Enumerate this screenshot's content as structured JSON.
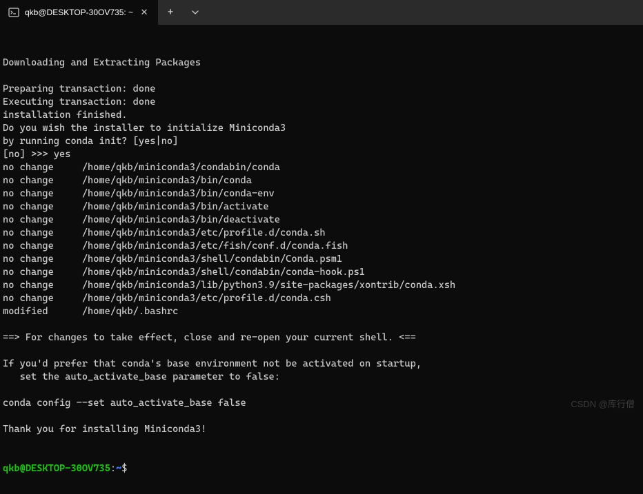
{
  "tab": {
    "title": "qkb@DESKTOP-30OV735: ~"
  },
  "terminal": {
    "lines": [
      "Downloading and Extracting Packages",
      "",
      "Preparing transaction: done",
      "Executing transaction: done",
      "installation finished.",
      "Do you wish the installer to initialize Miniconda3",
      "by running conda init? [yes|no]",
      "[no] >>> yes",
      "no change     /home/qkb/miniconda3/condabin/conda",
      "no change     /home/qkb/miniconda3/bin/conda",
      "no change     /home/qkb/miniconda3/bin/conda-env",
      "no change     /home/qkb/miniconda3/bin/activate",
      "no change     /home/qkb/miniconda3/bin/deactivate",
      "no change     /home/qkb/miniconda3/etc/profile.d/conda.sh",
      "no change     /home/qkb/miniconda3/etc/fish/conf.d/conda.fish",
      "no change     /home/qkb/miniconda3/shell/condabin/Conda.psm1",
      "no change     /home/qkb/miniconda3/shell/condabin/conda-hook.ps1",
      "no change     /home/qkb/miniconda3/lib/python3.9/site-packages/xontrib/conda.xsh",
      "no change     /home/qkb/miniconda3/etc/profile.d/conda.csh",
      "modified      /home/qkb/.bashrc",
      "",
      "==> For changes to take effect, close and re-open your current shell. <==",
      "",
      "If you'd prefer that conda's base environment not be activated on startup,",
      "   set the auto_activate_base parameter to false:",
      "",
      "conda config --set auto_activate_base false",
      "",
      "Thank you for installing Miniconda3!"
    ],
    "prompt": {
      "user_host": "qkb@DESKTOP-30OV735",
      "colon": ":",
      "path": "~",
      "symbol": "$"
    }
  },
  "watermark": "CSDN @库行僧"
}
